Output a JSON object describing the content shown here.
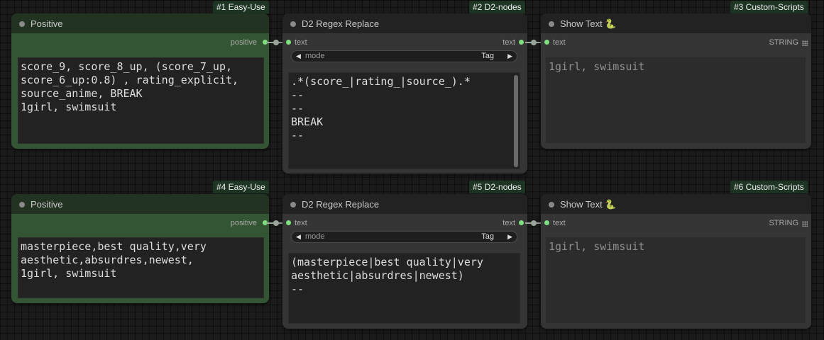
{
  "nodes": {
    "n1": {
      "badge": "#1 Easy-Use",
      "title": "Positive",
      "output": "positive",
      "text": "score_9, score_8_up, (score_7_up,\nscore_6_up:0.8) , rating_explicit,\nsource_anime, BREAK\n1girl, swimsuit"
    },
    "n2": {
      "badge": "#2 D2-nodes",
      "title": "D2 Regex Replace",
      "input": "text",
      "output": "text",
      "mode_label": "mode",
      "mode_value": "Tag",
      "text": ".*(score_|rating_|source_).*\n--\n--\nBREAK\n--"
    },
    "n3": {
      "badge": "#3 Custom-Scripts",
      "title": "Show Text 🐍",
      "input": "text",
      "output": "STRING",
      "text": "1girl, swimsuit"
    },
    "n4": {
      "badge": "#4 Easy-Use",
      "title": "Positive",
      "output": "positive",
      "text": "masterpiece,best quality,very\naesthetic,absurdres,newest,\n1girl, swimsuit"
    },
    "n5": {
      "badge": "#5 D2-nodes",
      "title": "D2 Regex Replace",
      "input": "text",
      "output": "text",
      "mode_label": "mode",
      "mode_value": "Tag",
      "text": "(masterpiece|best quality|very\naesthetic|absurdres|newest)\n--"
    },
    "n6": {
      "badge": "#6 Custom-Scripts",
      "title": "Show Text 🐍",
      "input": "text",
      "output": "STRING",
      "text": "1girl, swimsuit"
    }
  },
  "colors": {
    "slot": "#7ee07e",
    "green_node": "#335533",
    "badge": "#1e3524",
    "node": "#353535"
  },
  "icons": {
    "collapse": "circle-dot-icon",
    "left": "arrow-left-icon",
    "right": "arrow-right-icon",
    "grid": "grid-icon"
  }
}
